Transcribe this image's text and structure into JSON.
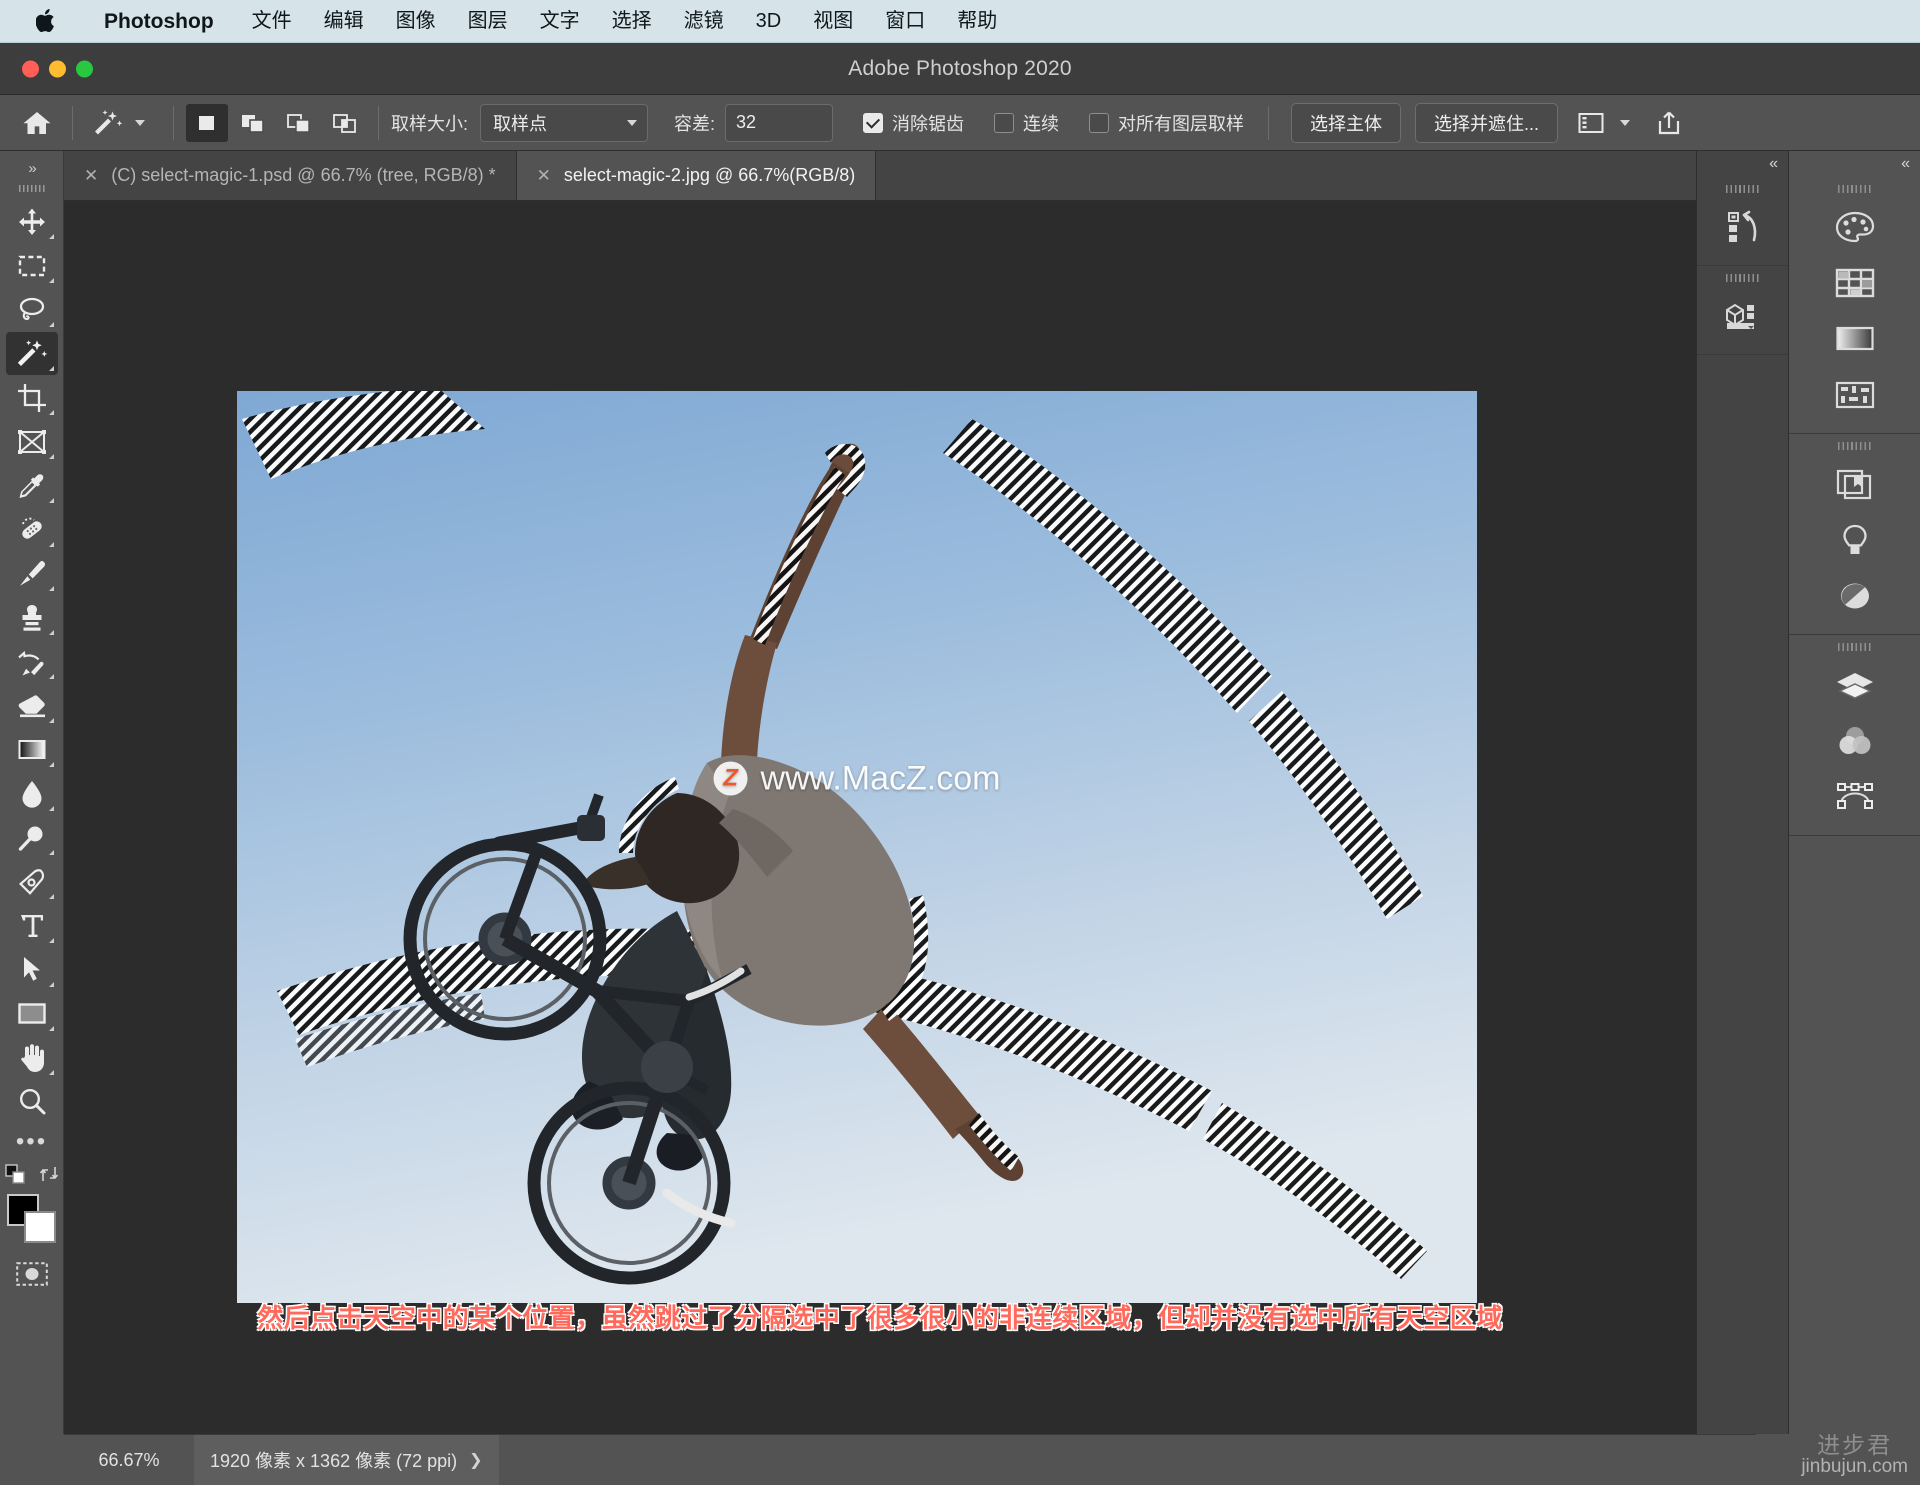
{
  "menubar": {
    "apple_icon": "apple-logo",
    "items": [
      "Photoshop",
      "文件",
      "编辑",
      "图像",
      "图层",
      "文字",
      "选择",
      "滤镜",
      "3D",
      "视图",
      "窗口",
      "帮助"
    ]
  },
  "titlebar": {
    "title": "Adobe Photoshop 2020"
  },
  "options": {
    "home_icon": "home-icon",
    "tool_icon": "magic-wand-icon",
    "selection_modes": [
      "new-selection-icon",
      "add-to-selection-icon",
      "subtract-from-selection-icon",
      "intersect-selection-icon"
    ],
    "sample_size_label": "取样大小:",
    "sample_size_value": "取样点",
    "tolerance_label": "容差:",
    "tolerance_value": "32",
    "antialias_label": "消除锯齿",
    "antialias_checked": true,
    "contiguous_label": "连续",
    "contiguous_checked": false,
    "sample_all_layers_label": "对所有图层取样",
    "sample_all_layers_checked": false,
    "select_subject_label": "选择主体",
    "select_and_mask_label": "选择并遮住...",
    "workspace_icon": "workspace-layout-icon",
    "share_icon": "share-upload-icon"
  },
  "tools": [
    {
      "name": "move-tool",
      "icon": "move-icon"
    },
    {
      "name": "marquee-tool",
      "icon": "rectangular-marquee-icon"
    },
    {
      "name": "lasso-tool",
      "icon": "lasso-icon"
    },
    {
      "name": "magic-wand-tool",
      "icon": "magic-wand-icon",
      "selected": true
    },
    {
      "name": "crop-tool",
      "icon": "crop-icon"
    },
    {
      "name": "frame-tool",
      "icon": "frame-icon"
    },
    {
      "name": "eyedropper-tool",
      "icon": "eyedropper-icon"
    },
    {
      "name": "healing-brush-tool",
      "icon": "healing-brush-icon"
    },
    {
      "name": "brush-tool",
      "icon": "brush-icon"
    },
    {
      "name": "clone-stamp-tool",
      "icon": "clone-stamp-icon"
    },
    {
      "name": "history-brush-tool",
      "icon": "history-brush-icon"
    },
    {
      "name": "eraser-tool",
      "icon": "eraser-icon"
    },
    {
      "name": "gradient-tool",
      "icon": "gradient-icon"
    },
    {
      "name": "blur-tool",
      "icon": "water-drop-icon"
    },
    {
      "name": "dodge-tool",
      "icon": "dodge-icon"
    },
    {
      "name": "pen-tool",
      "icon": "pen-icon"
    },
    {
      "name": "type-tool",
      "icon": "text-type-icon"
    },
    {
      "name": "path-selection-tool",
      "icon": "path-selection-arrow-icon"
    },
    {
      "name": "shape-tool",
      "icon": "rectangle-shape-icon"
    },
    {
      "name": "hand-tool",
      "icon": "hand-icon"
    },
    {
      "name": "zoom-tool",
      "icon": "magnifier-icon"
    }
  ],
  "tabs": [
    {
      "label": "(C) select-magic-1.psd @ 66.7% (tree, RGB/8) *",
      "active": false,
      "close_icon": "close-icon"
    },
    {
      "label": "select-magic-2.jpg @ 66.7%(RGB/8)",
      "active": true,
      "close_icon": "close-icon"
    }
  ],
  "canvas": {
    "watermark_text": "www.MacZ.com",
    "watermark_badge": "Z",
    "caption": "然后点击天空中的某个位置，虽然跳过了分隔选中了很多很小的非连续区域，但却并没有选中所有天空区域",
    "caption_color": "#ff6a5c"
  },
  "right_panels": {
    "collapse_icon": "double-chevron-left-icon",
    "mid_column": [
      {
        "name": "history-panel-icon",
        "icon": "history-icon"
      },
      {
        "name": "3d-panel-icon",
        "icon": "cube-3d-icon"
      }
    ],
    "far_column": [
      {
        "name": "color-panel-icon",
        "icon": "palette-icon"
      },
      {
        "name": "swatches-panel-icon",
        "icon": "swatches-grid-icon"
      },
      {
        "name": "gradients-panel-icon",
        "icon": "gradient-icon"
      },
      {
        "name": "patterns-panel-icon",
        "icon": "pattern-icon"
      },
      {
        "name": "libraries-panel-icon",
        "icon": "library-book-icon"
      },
      {
        "name": "adjustments-panel-icon",
        "icon": "light-bulb-icon"
      },
      {
        "name": "styles-panel-icon",
        "icon": "half-circle-icon"
      },
      {
        "name": "layers-panel-icon",
        "icon": "layers-stack-icon"
      },
      {
        "name": "channels-panel-icon",
        "icon": "channels-venn-icon"
      },
      {
        "name": "paths-panel-icon",
        "icon": "paths-bezier-icon"
      }
    ]
  },
  "statusbar": {
    "zoom": "66.67%",
    "doc_size": "1920 像素 x 1362 像素 (72 ppi)",
    "expand_icon": "chevron-right-icon"
  },
  "brand_watermark": {
    "cn": "进步君",
    "en": "jinbujun.com"
  }
}
